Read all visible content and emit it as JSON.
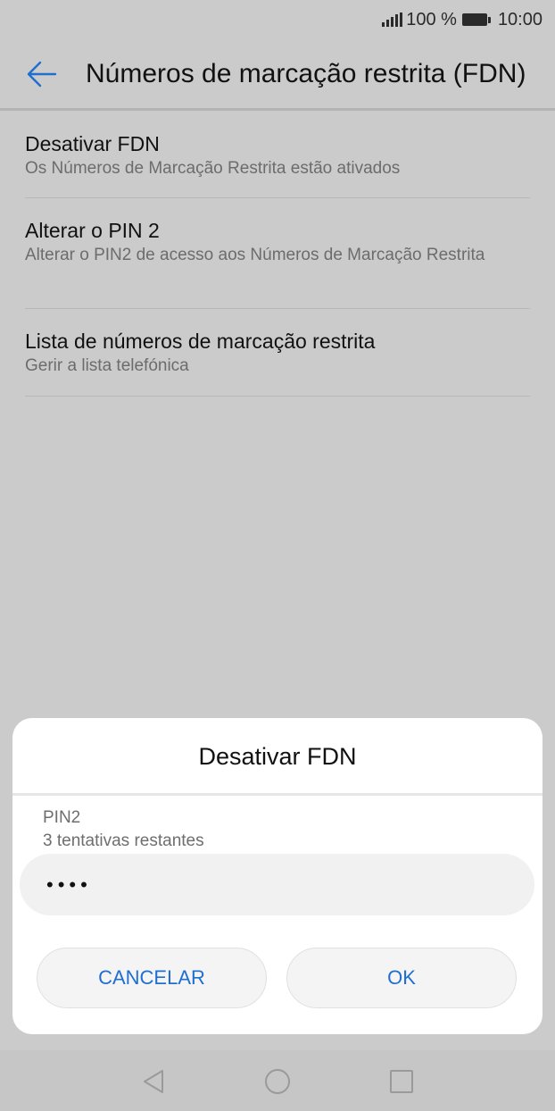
{
  "status_bar": {
    "battery": "100 %",
    "time": "10:00"
  },
  "header": {
    "title": "Números de marcação restrita (FDN)"
  },
  "settings": {
    "items": [
      {
        "title": "Desativar FDN",
        "subtitle": "Os Números de Marcação Restrita estão ativados"
      },
      {
        "title": "Alterar o PIN 2",
        "subtitle": "Alterar o PIN2 de acesso aos Números de Marcação Restrita"
      },
      {
        "title": "Lista de números de marcação restrita",
        "subtitle": "Gerir a lista telefónica"
      }
    ]
  },
  "dialog": {
    "title": "Desativar FDN",
    "field_label": "PIN2",
    "field_hint": "3 tentativas restantes",
    "pin_value": "••••",
    "cancel_label": "CANCELAR",
    "ok_label": "OK"
  },
  "colors": {
    "accent": "#1e6fd0",
    "scrim_background": "#cbcbcb",
    "dialog_background": "#ffffff"
  },
  "icons": {
    "back": "arrow-left-icon",
    "nav_back": "triangle-back-icon",
    "nav_home": "circle-home-icon",
    "nav_recents": "square-recents-icon"
  }
}
